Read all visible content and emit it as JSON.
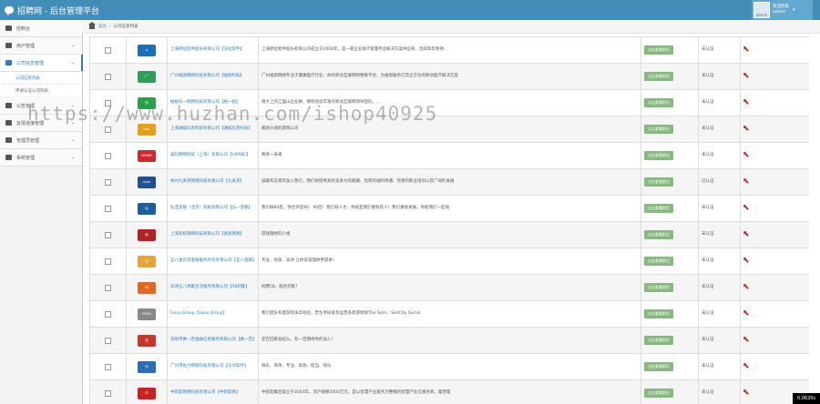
{
  "app": {
    "title": "招聘网 - 后台管理平台",
    "icon": "chat-bubble-icon"
  },
  "user": {
    "greeting": "欢迎回来",
    "name": "admin",
    "avatar_label": "admin"
  },
  "sidebar": {
    "items": [
      {
        "label": "控制台",
        "icon": "tachometer-icon",
        "active": false,
        "has_arrow": false
      },
      {
        "label": "用户管理",
        "icon": "users-icon",
        "active": false,
        "has_arrow": true
      },
      {
        "label": "公司信息管理",
        "icon": "list-icon",
        "active": true,
        "has_arrow": true
      },
      {
        "label": "公告管理",
        "icon": "desktop-icon",
        "active": false,
        "has_arrow": true
      },
      {
        "label": "友情连接管理",
        "icon": "heart-icon",
        "active": false,
        "has_arrow": true
      },
      {
        "label": "管理员管理",
        "icon": "gear-icon",
        "active": false,
        "has_arrow": true
      },
      {
        "label": "系统管理",
        "icon": "cogs-icon",
        "active": false,
        "has_arrow": true
      }
    ],
    "subitems": [
      {
        "label": "公司信息列表",
        "current": true
      },
      {
        "label": "申请认证公司列表",
        "current": false
      }
    ]
  },
  "breadcrumb": {
    "home": "首页",
    "current": "公司信息列表"
  },
  "table": {
    "button_label": "点击查看职位",
    "rows": [
      {
        "logo": "A",
        "logo_color": "#1a6fb5",
        "name": "上海原拉软件股份有限公司【沃拉软件】",
        "desc": "上海原拉软件股份有限公司成立于2008年，是一家企业级IT管理平台解决方案供应商，连续四年保持...",
        "status": "未认证"
      },
      {
        "logo": "广",
        "logo_color": "#2e9c5a",
        "name": "广州福恩网络科技有限公司【福恩科技】",
        "desc": "广州福恩网络专注于健康医疗行业，依托移动互联网和物联平台，为福恩服务打造全方位的移动医疗解决方案",
        "status": "未认证"
      },
      {
        "logo": "拍",
        "logo_color": "#27a24a",
        "name": "拍拍乐一网络科技有限公司【拍一拍】",
        "desc": "南大上的江面山企业精，拥有经验丰富的移动互联网领导团队，...",
        "status": "未认证"
      },
      {
        "logo": "ww",
        "logo_color": "#e0a020",
        "name": "上海通娱信息科技有限公司【通娱信息科技】",
        "desc": "最具价值的游戏公司",
        "status": "未认证"
      },
      {
        "logo": "VIPABC",
        "logo_color": "#d0282e",
        "name": "威比网络科技（上海）有限公司【VIPABC】",
        "desc": "教育一未来",
        "status": "未认证"
      },
      {
        "logo": "Jiuye",
        "logo_color": "#1d4f91",
        "name": "杭州九采英网络科技有限公司【九采英】",
        "desc": "诚邀有志青年加入我们，我们将提供具有竞争力的薪酬、优厚的福利待遇、完善的职业培训以及广阔的发展",
        "status": "已认证"
      },
      {
        "logo": "弘",
        "logo_color": "#1a5da0",
        "name": "弘亚美联（北京）科技有限公司【弘一亚联】",
        "desc": "我们缺80后，你也许是80、90后！我们缺人才，你就是我们要找的人！我们重视发展，你能我们一起进",
        "status": "未认证"
      },
      {
        "logo": "校",
        "logo_color": "#b22222",
        "name": "上海高校网络科技有限公司【高校网络】",
        "desc": "游戏理想的小组",
        "status": "未认证"
      },
      {
        "logo": "云",
        "logo_color": "#e8a33a",
        "name": "五八金云资金融服务外包有限公司【五八金融】",
        "desc": "专业、优质、高效 让你说道理财更容易！",
        "status": "未认证"
      },
      {
        "logo": "58",
        "logo_color": "#e06820",
        "name": "天津五八到家生活服务有限公司【58到家】",
        "desc": "招聘58，服务到家！",
        "status": "未认证"
      },
      {
        "logo": "GOSU",
        "logo_color": "#888888",
        "name": "Gosu Group【Gosu Group】",
        "desc": "我们团队有着游戏多年经验，曾负责研发及运营多款游戏如The Sims、SimCity Social",
        "status": "未认证"
      },
      {
        "logo": "百",
        "logo_color": "#c0392b",
        "name": "深圳市惠一百金融信息服务有限公司【惠一百】",
        "desc": "还在回家会起么，有一百期待你的加入！",
        "status": "未认证"
      },
      {
        "logo": "利",
        "logo_color": "#2a6cb5",
        "name": "广州市佐力网络科技有限公司【乐达软件】",
        "desc": "快乐、简单、专注、高效、担当、快乐",
        "status": "未认证"
      },
      {
        "logo": "中",
        "logo_color": "#cc1f1f",
        "name": "中航软网络科技有限公司【中航软来】",
        "desc": "中航软集团成立于2003年，资产规模5000万元，是以智慧产业服务为整数的智慧产业云服务商，集营理",
        "status": "未认证"
      }
    ]
  },
  "watermark": "https://www.huzhan.com/ishop40925",
  "timer": "0.0620s",
  "colors": {
    "navbar": "#438eb9",
    "link": "#2b7dbc",
    "button": "#87b87f"
  }
}
